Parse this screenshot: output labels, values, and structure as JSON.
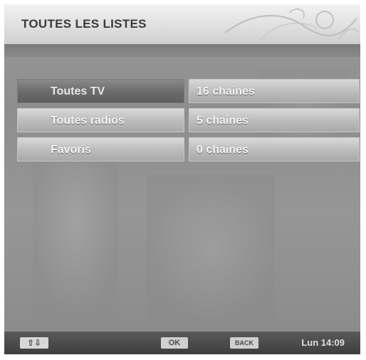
{
  "header": {
    "title": "TOUTES LES LISTES"
  },
  "lists": [
    {
      "name": "Toutes TV",
      "count": "16 chaines",
      "selected": true
    },
    {
      "name": "Toutes radios",
      "count": "5 chaines",
      "selected": false
    },
    {
      "name": "Favoris",
      "count": "0 chaines",
      "selected": false
    }
  ],
  "footer": {
    "nav_icon": "up-down-arrows-icon",
    "nav_glyph": "⇧⇩",
    "ok_label": "OK",
    "back_label": "BACK",
    "clock": "Lun 14:09"
  }
}
